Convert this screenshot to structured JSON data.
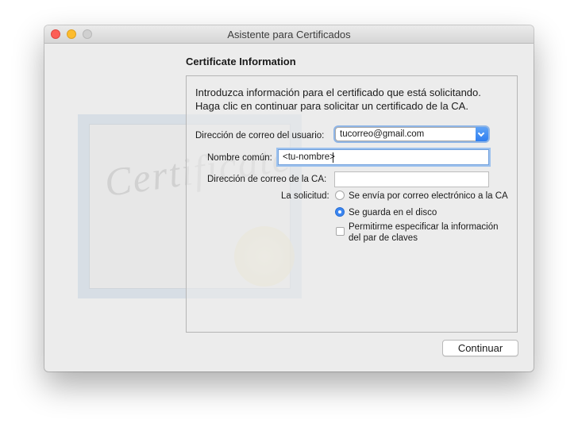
{
  "window": {
    "title": "Asistente para Certificados"
  },
  "certificate_image": {
    "word": "Certificate"
  },
  "section": {
    "title": "Certificate Information"
  },
  "intro": {
    "line1": "Introduzca información para el certificado que está solicitando.",
    "line2": "Haga clic en continuar para solicitar un certificado de la CA."
  },
  "form": {
    "email": {
      "label": "Dirección de correo del usuario:",
      "value": "tucorreo@gmail.com"
    },
    "common_name": {
      "label": "Nombre común:",
      "value": "<tu-nombre>"
    },
    "ca_email": {
      "label": "Dirección de correo de la CA:",
      "value": ""
    },
    "request": {
      "label": "La solicitud:",
      "options": [
        {
          "label": "Se envía por correo electrónico a la CA",
          "selected": false
        },
        {
          "label": "Se guarda en el disco",
          "selected": true
        }
      ]
    },
    "key_pair": {
      "label_line1": "Permitirme especificar la información",
      "label_line2": "del par de claves",
      "checked": false
    }
  },
  "buttons": {
    "continue": "Continuar"
  },
  "colors": {
    "accent": "#3b86f1",
    "focus_ring": "#9ec2ee",
    "close": "#fc5f57",
    "minimize": "#fdbc2e"
  }
}
